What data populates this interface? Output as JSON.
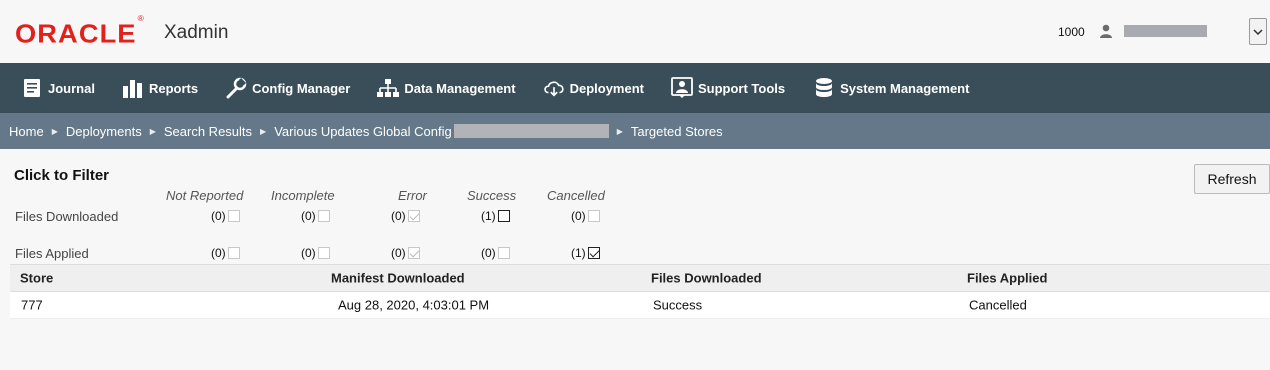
{
  "header": {
    "logo": "ORACLE",
    "logo_mark": "®",
    "app_name": "Xadmin",
    "store_number": "1000"
  },
  "nav": {
    "items": [
      {
        "label": "Journal",
        "icon": "journal-icon"
      },
      {
        "label": "Reports",
        "icon": "bar-chart-icon"
      },
      {
        "label": "Config Manager",
        "icon": "wrench-icon"
      },
      {
        "label": "Data Management",
        "icon": "hierarchy-icon"
      },
      {
        "label": "Deployment",
        "icon": "cloud-download-icon"
      },
      {
        "label": "Support Tools",
        "icon": "support-person-icon"
      },
      {
        "label": "System Management",
        "icon": "database-icon"
      }
    ]
  },
  "breadcrumb": {
    "items": [
      "Home",
      "Deployments",
      "Search Results",
      "Various Updates Global Config",
      "Targeted Stores"
    ]
  },
  "filter": {
    "title": "Click to Filter",
    "columns": [
      "Not Reported",
      "Incomplete",
      "Error",
      "Success",
      "Cancelled"
    ],
    "rows": [
      {
        "label": "Files Downloaded",
        "counts": [
          "(0)",
          "(0)",
          "(0)",
          "(1)",
          "(0)"
        ]
      },
      {
        "label": "Files Applied",
        "counts": [
          "(0)",
          "(0)",
          "(0)",
          "(0)",
          "(1)"
        ]
      }
    ]
  },
  "refresh_label": "Refresh",
  "table": {
    "headers": [
      "Store",
      "Manifest Downloaded",
      "Files Downloaded",
      "Files Applied"
    ],
    "rows": [
      [
        "777",
        "Aug 28, 2020, 4:03:01 PM",
        "Success",
        "Cancelled"
      ]
    ]
  },
  "colors": {
    "brand_red": "#e3201b",
    "nav_bg": "#3a4e5a",
    "breadcrumb_bg": "#64788a"
  }
}
